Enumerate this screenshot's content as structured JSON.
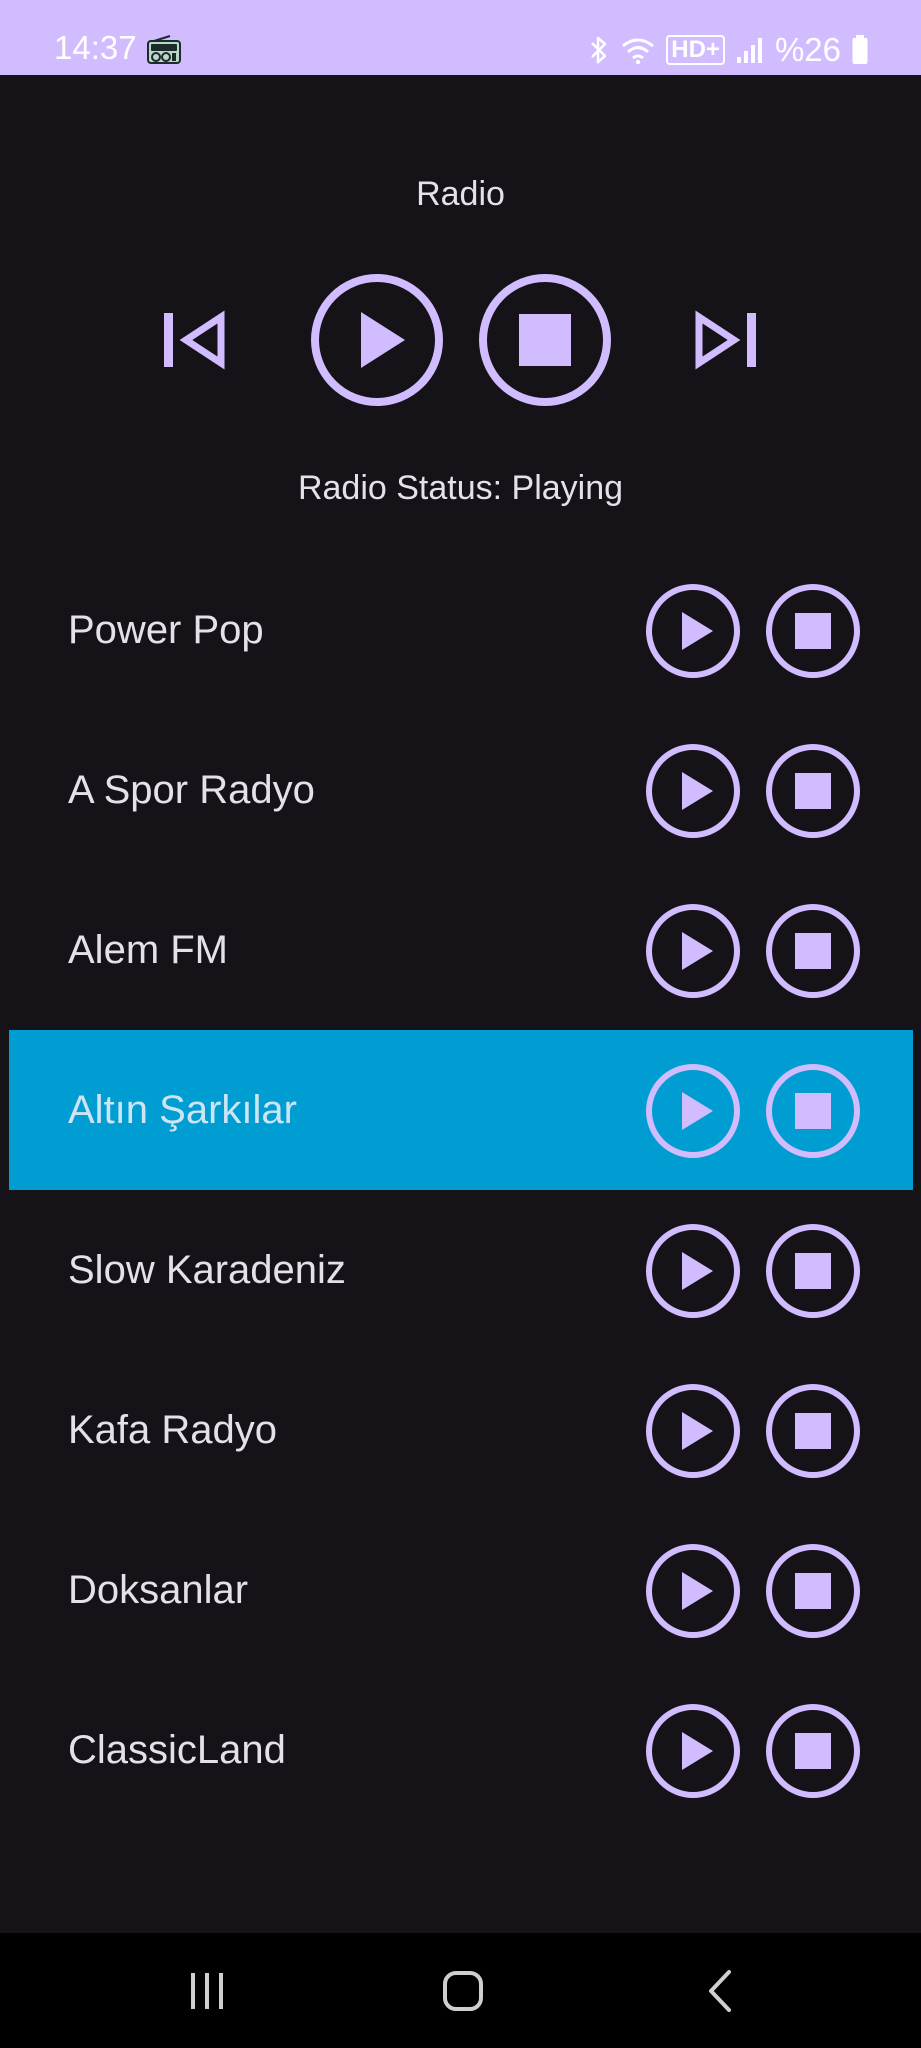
{
  "status_bar": {
    "time": "14:37",
    "battery": "%26",
    "network": "HD+",
    "icons": [
      "radio-icon",
      "bluetooth-icon",
      "wifi-icon",
      "hd-voice-icon",
      "signal-icon",
      "battery-icon"
    ]
  },
  "app": {
    "title": "Radio",
    "status_text": "Radio Status: Playing",
    "controls": [
      "previous-icon",
      "play-icon",
      "stop-icon",
      "next-icon"
    ]
  },
  "stations": [
    {
      "name": "Power Pop",
      "selected": false
    },
    {
      "name": "A Spor Radyo",
      "selected": false
    },
    {
      "name": "Alem FM",
      "selected": false
    },
    {
      "name": "Altın Şarkılar",
      "selected": true
    },
    {
      "name": "Slow Karadeniz",
      "selected": false
    },
    {
      "name": "Kafa Radyo",
      "selected": false
    },
    {
      "name": "Doksanlar",
      "selected": false
    },
    {
      "name": "ClassicLand",
      "selected": false
    }
  ],
  "colors": {
    "accent": "#d0bcff",
    "background": "#151218",
    "selected_row": "#009dd3",
    "text": "#e6e0e9",
    "nav_background": "#000000"
  },
  "nav_bar": {
    "buttons": [
      "recent-apps-icon",
      "home-icon",
      "back-icon"
    ]
  }
}
